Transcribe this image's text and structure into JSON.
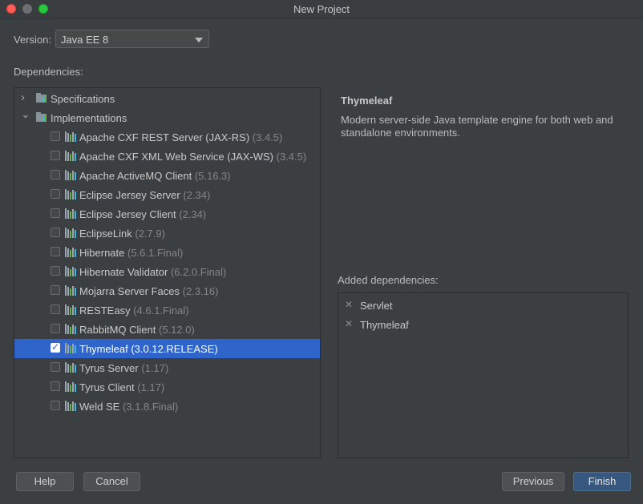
{
  "window": {
    "title": "New Project"
  },
  "version": {
    "label": "Version:",
    "value": "Java EE 8"
  },
  "dependencies_label": "Dependencies:",
  "tree": {
    "groups": [
      {
        "label": "Specifications",
        "expanded": false
      },
      {
        "label": "Implementations",
        "expanded": true
      }
    ],
    "items": [
      {
        "name": "Apache CXF REST Server (JAX-RS)",
        "version": "(3.4.5)",
        "checked": false,
        "selected": false
      },
      {
        "name": "Apache CXF XML Web Service (JAX-WS)",
        "version": "(3.4.5)",
        "checked": false,
        "selected": false
      },
      {
        "name": "Apache ActiveMQ Client",
        "version": "(5.16.3)",
        "checked": false,
        "selected": false
      },
      {
        "name": "Eclipse Jersey Server",
        "version": "(2.34)",
        "checked": false,
        "selected": false
      },
      {
        "name": "Eclipse Jersey Client",
        "version": "(2.34)",
        "checked": false,
        "selected": false
      },
      {
        "name": "EclipseLink",
        "version": "(2.7.9)",
        "checked": false,
        "selected": false
      },
      {
        "name": "Hibernate",
        "version": "(5.6.1.Final)",
        "checked": false,
        "selected": false
      },
      {
        "name": "Hibernate Validator",
        "version": "(6.2.0.Final)",
        "checked": false,
        "selected": false
      },
      {
        "name": "Mojarra Server Faces",
        "version": "(2.3.16)",
        "checked": false,
        "selected": false
      },
      {
        "name": "RESTEasy",
        "version": "(4.6.1.Final)",
        "checked": false,
        "selected": false
      },
      {
        "name": "RabbitMQ Client",
        "version": "(5.12.0)",
        "checked": false,
        "selected": false
      },
      {
        "name": "Thymeleaf",
        "version": "(3.0.12.RELEASE)",
        "checked": true,
        "selected": true
      },
      {
        "name": "Tyrus Server",
        "version": "(1.17)",
        "checked": false,
        "selected": false
      },
      {
        "name": "Tyrus Client",
        "version": "(1.17)",
        "checked": false,
        "selected": false
      },
      {
        "name": "Weld SE",
        "version": "(3.1.8.Final)",
        "checked": false,
        "selected": false
      }
    ]
  },
  "detail": {
    "title": "Thymeleaf",
    "description": "Modern server-side Java template engine for both web and standalone environments."
  },
  "added": {
    "label": "Added dependencies:",
    "items": [
      "Servlet",
      "Thymeleaf"
    ]
  },
  "buttons": {
    "help": "Help",
    "cancel": "Cancel",
    "previous": "Previous",
    "finish": "Finish"
  },
  "colors": {
    "background": "#3c3f41",
    "selection": "#2f65ca",
    "primary_button": "#365880"
  },
  "icons": {
    "group": "library-folder-icon",
    "item": "library-bars-icon",
    "remove": "remove-x-icon"
  }
}
